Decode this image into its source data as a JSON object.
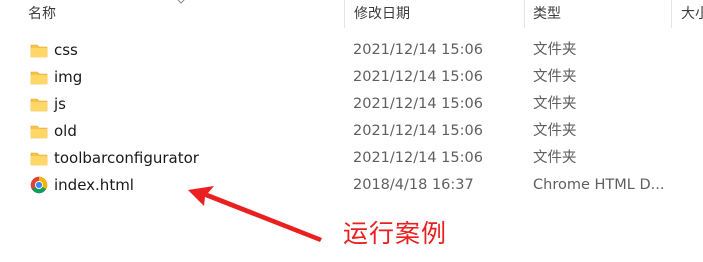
{
  "columns": {
    "name": "名称",
    "modified": "修改日期",
    "type": "类型",
    "size": "大小"
  },
  "files": [
    {
      "icon": "folder-icon",
      "name": "css",
      "modified": "2021/12/14 15:06",
      "type": "文件夹"
    },
    {
      "icon": "folder-icon",
      "name": "img",
      "modified": "2021/12/14 15:06",
      "type": "文件夹"
    },
    {
      "icon": "folder-icon",
      "name": "js",
      "modified": "2021/12/14 15:06",
      "type": "文件夹"
    },
    {
      "icon": "folder-icon",
      "name": "old",
      "modified": "2021/12/14 15:06",
      "type": "文件夹"
    },
    {
      "icon": "folder-icon",
      "name": "toolbarconfigurator",
      "modified": "2021/12/14 15:06",
      "type": "文件夹"
    },
    {
      "icon": "chrome-icon",
      "name": "index.html",
      "modified": "2018/4/18 16:37",
      "type": "Chrome HTML D..."
    }
  ],
  "annotation": {
    "text": "运行案例",
    "color": "#ea1f1f"
  },
  "colors": {
    "folder": "#f6c24a",
    "folder_dark": "#e0a82a",
    "arrow": "#ea1f1f"
  }
}
